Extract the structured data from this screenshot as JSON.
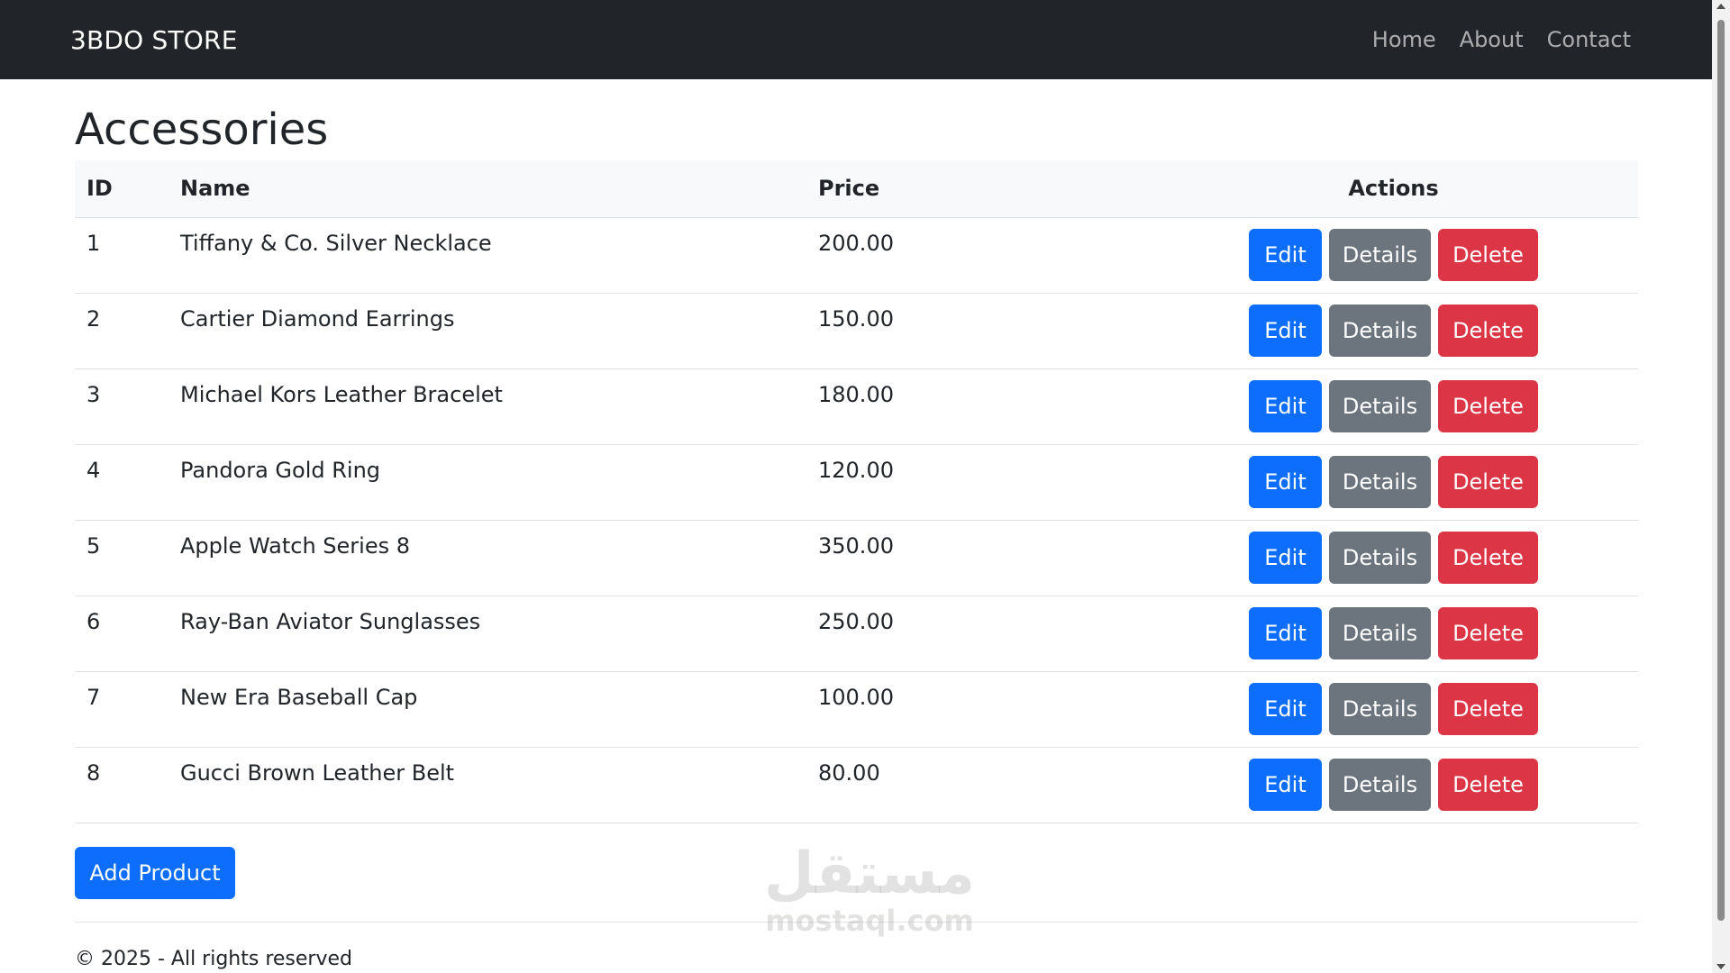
{
  "navbar": {
    "brand": "3BDO STORE",
    "links": [
      "Home",
      "About",
      "Contact"
    ]
  },
  "page": {
    "title": "Accessories"
  },
  "table": {
    "headers": {
      "id": "ID",
      "name": "Name",
      "price": "Price",
      "actions": "Actions"
    },
    "rows": [
      {
        "id": "1",
        "name": "Tiffany & Co. Silver Necklace",
        "price": "200.00"
      },
      {
        "id": "2",
        "name": "Cartier Diamond Earrings",
        "price": "150.00"
      },
      {
        "id": "3",
        "name": "Michael Kors Leather Bracelet",
        "price": "180.00"
      },
      {
        "id": "4",
        "name": "Pandora Gold Ring",
        "price": "120.00"
      },
      {
        "id": "5",
        "name": "Apple Watch Series 8",
        "price": "350.00"
      },
      {
        "id": "6",
        "name": "Ray-Ban Aviator Sunglasses",
        "price": "250.00"
      },
      {
        "id": "7",
        "name": "New Era Baseball Cap",
        "price": "100.00"
      },
      {
        "id": "8",
        "name": "Gucci Brown Leather Belt",
        "price": "80.00"
      }
    ],
    "actions": {
      "edit": "Edit",
      "details": "Details",
      "delete": "Delete"
    }
  },
  "add_button": "Add Product",
  "footer": "© 2025 - All rights reserved",
  "watermark": {
    "arabic": "مستقل",
    "latin": "mostaql.com"
  },
  "colors": {
    "navbar": "#212529",
    "primary": "#0d6efd",
    "secondary": "#6c757d",
    "danger": "#dc3545"
  }
}
